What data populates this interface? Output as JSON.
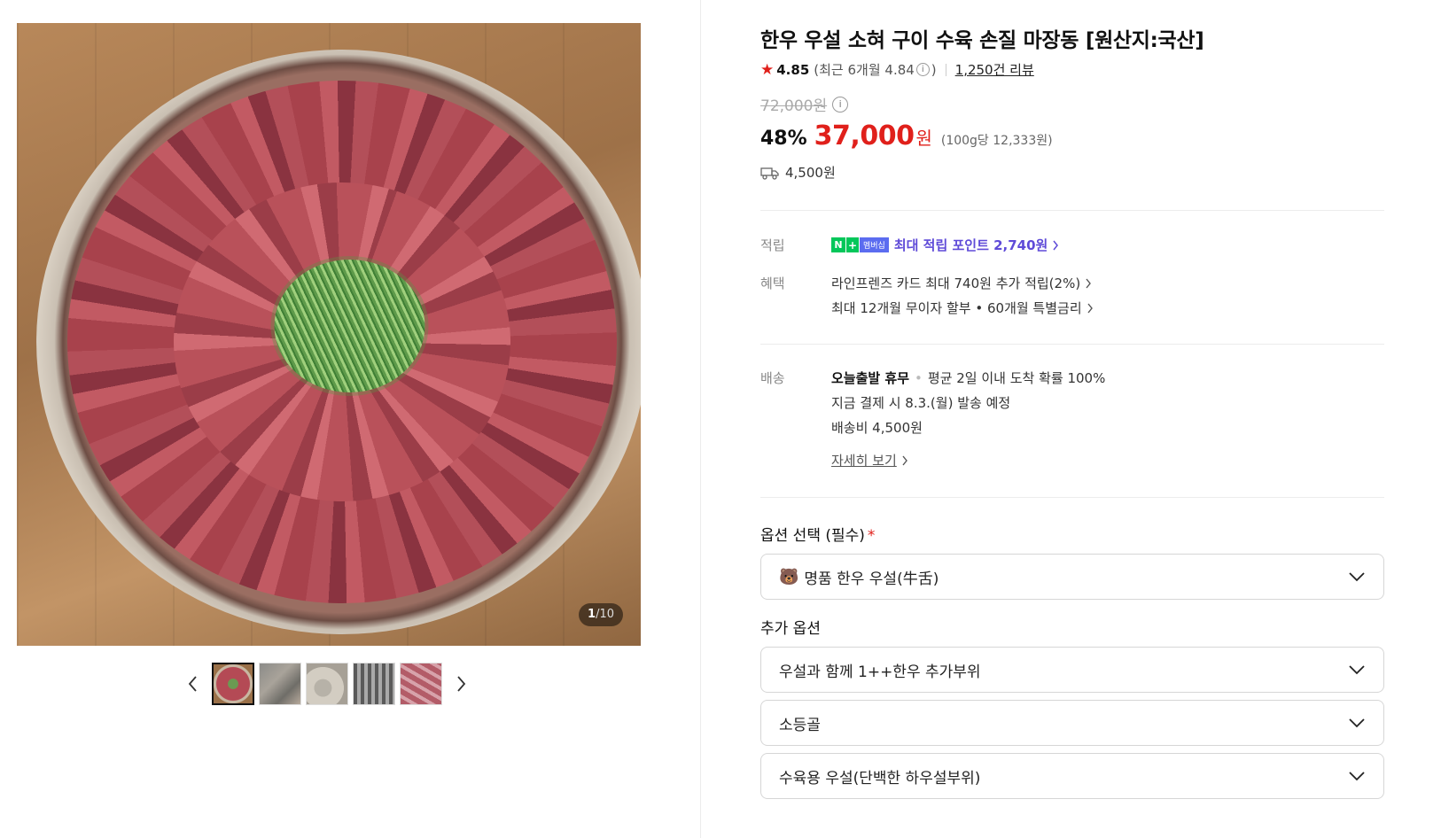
{
  "gallery": {
    "counter_current": "1",
    "counter_total": "/10",
    "thumbnails": [
      "thumb-1",
      "thumb-2",
      "thumb-3",
      "thumb-4",
      "thumb-5"
    ],
    "active_thumbnail": 1
  },
  "product": {
    "title": "한우 우설 소혀 구이 수육 손질 마장동 [원산지:국산]",
    "rating": "4.85",
    "recent_rating_prefix": "(최근 6개월 4.84",
    "recent_rating_suffix": ")",
    "review_count": "1,250건 리뷰",
    "original_price": "72,000원",
    "discount": "48%",
    "sale_price": "37,000",
    "currency": "원",
    "unit_price": "(100g당 12,333원)",
    "shipping_fee": "4,500원"
  },
  "benefits": {
    "points_label": "적립",
    "points_badge_n": "N",
    "points_badge_plus": "+",
    "points_badge_member": "멤버십",
    "points_text": "최대 적립 포인트 2,740원",
    "benefit_label": "혜택",
    "benefit_lines": [
      "라인프렌즈 카드 최대 740원 추가 적립(2%)",
      "최대 12개월 무이자 할부 • 60개월 특별금리"
    ]
  },
  "delivery": {
    "label": "배송",
    "status_bold": "오늘출발 휴무",
    "status_detail": "평균 2일 이내 도착 확률 100%",
    "ship_date": "지금 결제 시 8.3.(월) 발송 예정",
    "fee": "배송비 4,500원",
    "detail_link": "자세히 보기"
  },
  "options": {
    "required_title": "옵션 선택 (필수)",
    "required_mark": "*",
    "required_value": "명품 한우 우설(牛舌)",
    "extra_title": "추가 옵션",
    "extra": [
      "우설과 함께 1++한우 추가부위",
      "소등골",
      "수육용 우설(단백한 하우설부위)"
    ]
  },
  "colors": {
    "accent_red": "#e0201b",
    "points_purple": "#5f4bd8",
    "naver_green": "#03c75a"
  },
  "icons": {
    "rating": "star-icon",
    "shipping": "truck-icon",
    "info": "info-circle-icon",
    "select": "chevron-down-icon",
    "gallery_prev": "chevron-left-icon",
    "gallery_next": "chevron-right-icon",
    "option": "bear-emoji-icon"
  }
}
